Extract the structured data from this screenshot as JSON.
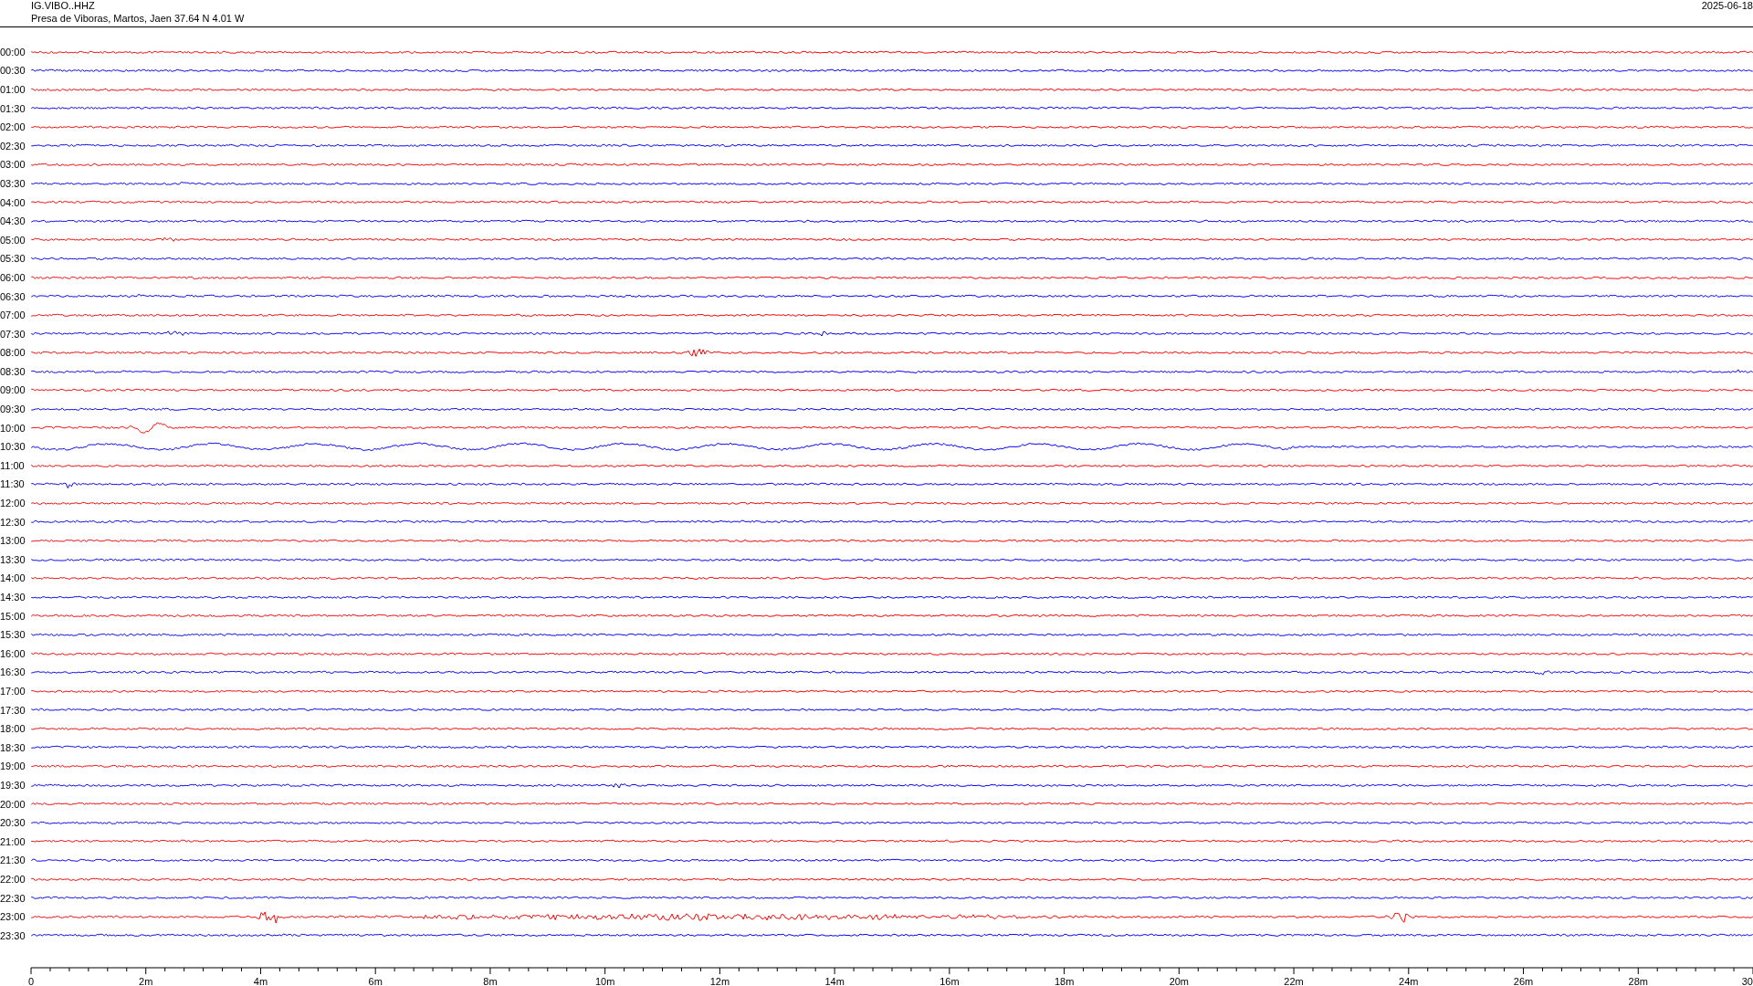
{
  "header": {
    "station": "IG.VIBO..HHZ",
    "location": "Presa de Viboras, Martos, Jaen  37.64 N 4.01 W",
    "date": "2025-06-18"
  },
  "rows": [
    {
      "time": "00:00",
      "color": "#ff0000"
    },
    {
      "time": "00:30",
      "color": "#0000ff"
    },
    {
      "time": "01:00",
      "color": "#ff0000"
    },
    {
      "time": "01:30",
      "color": "#0000ff"
    },
    {
      "time": "02:00",
      "color": "#ff0000"
    },
    {
      "time": "02:30",
      "color": "#0000ff"
    },
    {
      "time": "03:00",
      "color": "#ff0000"
    },
    {
      "time": "03:30",
      "color": "#0000ff"
    },
    {
      "time": "04:00",
      "color": "#ff0000"
    },
    {
      "time": "04:30",
      "color": "#0000ff"
    },
    {
      "time": "05:00",
      "color": "#ff0000"
    },
    {
      "time": "05:30",
      "color": "#0000ff"
    },
    {
      "time": "06:00",
      "color": "#ff0000"
    },
    {
      "time": "06:30",
      "color": "#0000ff"
    },
    {
      "time": "07:00",
      "color": "#ff0000"
    },
    {
      "time": "07:30",
      "color": "#0000ff"
    },
    {
      "time": "08:00",
      "color": "#ff0000"
    },
    {
      "time": "08:30",
      "color": "#0000ff"
    },
    {
      "time": "09:00",
      "color": "#ff0000"
    },
    {
      "time": "09:30",
      "color": "#0000ff"
    },
    {
      "time": "10:00",
      "color": "#ff0000"
    },
    {
      "time": "10:30",
      "color": "#0000ff"
    },
    {
      "time": "11:00",
      "color": "#ff0000"
    },
    {
      "time": "11:30",
      "color": "#0000ff"
    },
    {
      "time": "12:00",
      "color": "#ff0000"
    },
    {
      "time": "12:30",
      "color": "#0000ff"
    },
    {
      "time": "13:00",
      "color": "#ff0000"
    },
    {
      "time": "13:30",
      "color": "#0000ff"
    },
    {
      "time": "14:00",
      "color": "#ff0000"
    },
    {
      "time": "14:30",
      "color": "#0000ff"
    },
    {
      "time": "15:00",
      "color": "#ff0000"
    },
    {
      "time": "15:30",
      "color": "#0000ff"
    },
    {
      "time": "16:00",
      "color": "#ff0000"
    },
    {
      "time": "16:30",
      "color": "#0000ff"
    },
    {
      "time": "17:00",
      "color": "#ff0000"
    },
    {
      "time": "17:30",
      "color": "#0000ff"
    },
    {
      "time": "18:00",
      "color": "#ff0000"
    },
    {
      "time": "18:30",
      "color": "#0000ff"
    },
    {
      "time": "19:00",
      "color": "#ff0000"
    },
    {
      "time": "19:30",
      "color": "#0000ff"
    },
    {
      "time": "20:00",
      "color": "#ff0000"
    },
    {
      "time": "20:30",
      "color": "#0000ff"
    },
    {
      "time": "21:00",
      "color": "#ff0000"
    },
    {
      "time": "21:30",
      "color": "#0000ff"
    },
    {
      "time": "22:00",
      "color": "#ff0000"
    },
    {
      "time": "22:30",
      "color": "#0000ff"
    },
    {
      "time": "23:00",
      "color": "#ff0000"
    },
    {
      "time": "23:30",
      "color": "#0000ff"
    }
  ],
  "axis": {
    "ticks": [
      "0",
      "2m",
      "4m",
      "6m",
      "8m",
      "10m",
      "12m",
      "14m",
      "16m",
      "18m",
      "20m",
      "22m",
      "24m",
      "26m",
      "28m",
      "30"
    ]
  }
}
